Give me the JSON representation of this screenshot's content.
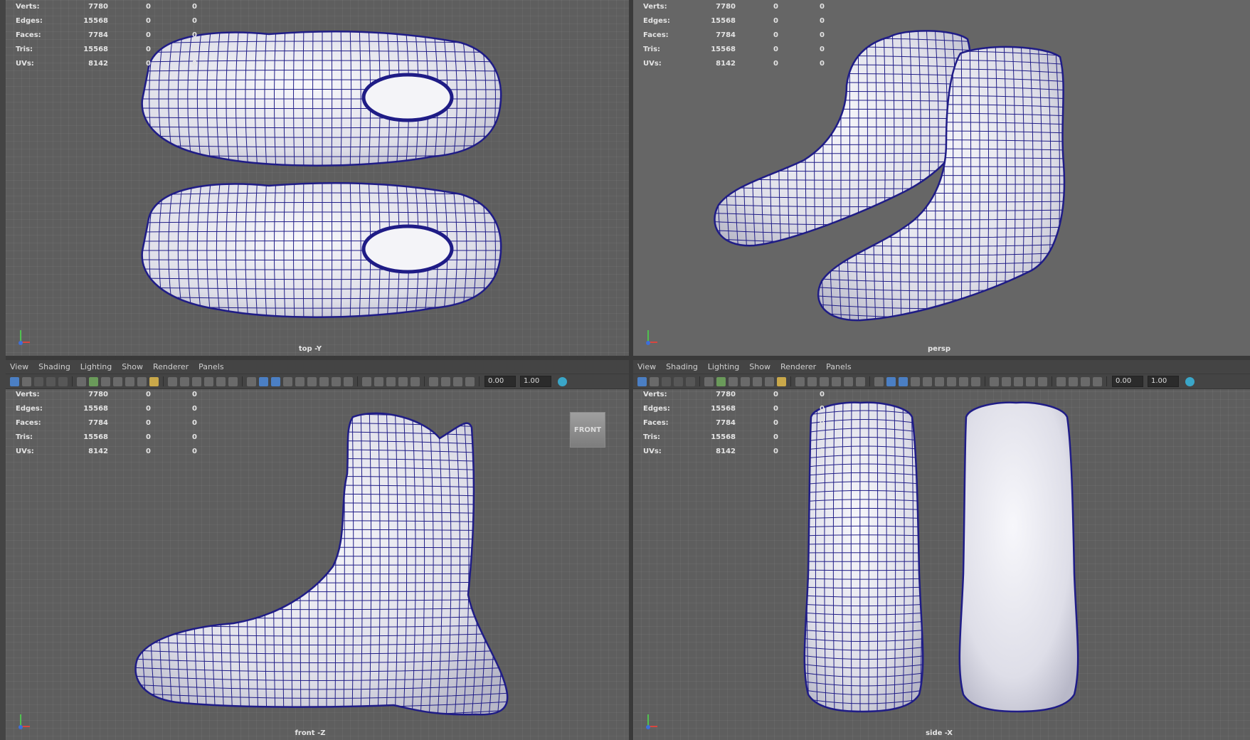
{
  "stats": {
    "labels": [
      "Verts:",
      "Edges:",
      "Faces:",
      "Tris:",
      "UVs:"
    ],
    "values": [
      "7780",
      "15568",
      "7784",
      "15568",
      "8142"
    ],
    "zeros": "0"
  },
  "menu": [
    "View",
    "Shading",
    "Lighting",
    "Show",
    "Renderer",
    "Panels"
  ],
  "toolbar": {
    "exposure": "0.00",
    "gamma": "1.00"
  },
  "viewports": {
    "top": {
      "camera": "top -Y"
    },
    "persp": {
      "camera": "persp"
    },
    "front": {
      "camera": "front -Z",
      "viewcube": "FRONT"
    },
    "side": {
      "camera": "side -X"
    }
  },
  "colors": {
    "wire": "#1f1c86",
    "surface": "#ececf2",
    "viewport_bg": "#5e5e5e",
    "panel": "#444444"
  }
}
